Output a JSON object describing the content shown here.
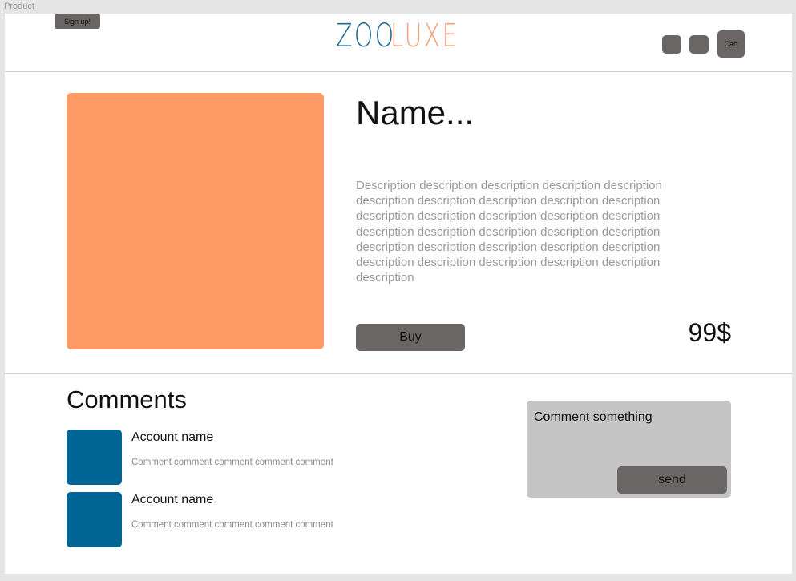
{
  "frame": {
    "label": "Product"
  },
  "header": {
    "signup_label": "Sign up!",
    "logo": {
      "part1": "ZOO",
      "part2": "LUXE",
      "color_part1": "#1e6a8d",
      "color_part2": "#f4a07a"
    },
    "icons": [
      "icon-button",
      "icon-button"
    ],
    "cart_label": "Cart"
  },
  "product": {
    "name": "Name...",
    "description": "Description description description description description description description description description description description description description description description description description description description description description description description description description description description description description description description",
    "buy_label": "Buy",
    "price": "99$",
    "image_color": "#ff9966"
  },
  "comments": {
    "title": "Comments",
    "items": [
      {
        "account": "Account name",
        "text": "Comment comment comment comment comment"
      },
      {
        "account": "Account name",
        "text": "Comment comment comment comment comment"
      }
    ],
    "avatar_color": "#006594",
    "input_placeholder": "Comment something",
    "send_label": "send"
  }
}
